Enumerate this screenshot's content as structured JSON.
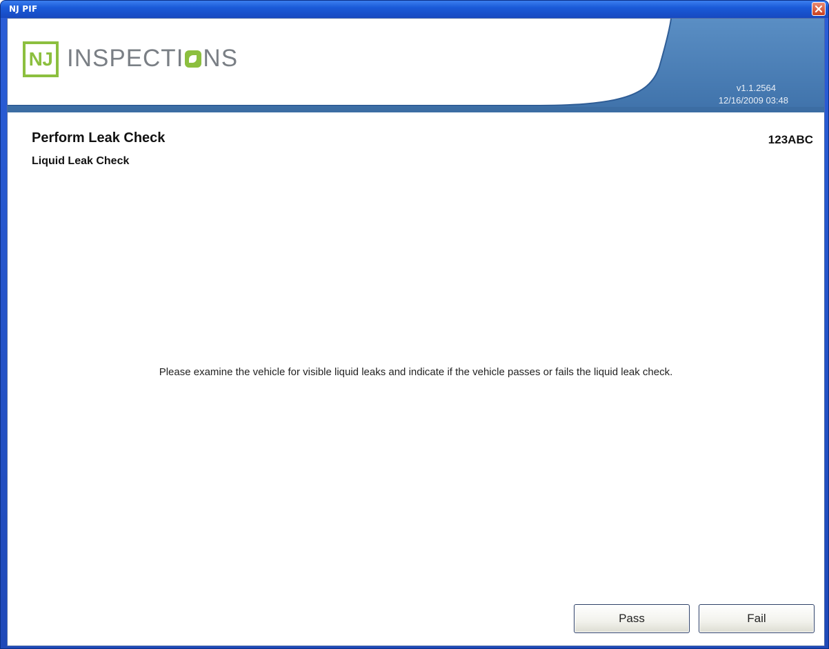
{
  "window": {
    "title": "NJ PIF"
  },
  "header": {
    "logo_mark": "NJ",
    "logo_text_before": "INSPECTI",
    "logo_text_after": "NS",
    "version": "v1.1.2564",
    "datetime": "12/16/2009 03:48"
  },
  "page": {
    "title": "Perform Leak Check",
    "subtitle": "Liquid Leak Check",
    "plate": "123ABC",
    "instructions": "Please examine the vehicle for visible liquid leaks and indicate if the vehicle passes or fails the liquid leak check."
  },
  "buttons": {
    "pass_label": "Pass",
    "fail_label": "Fail"
  },
  "colors": {
    "brand_green": "#8cbf3f",
    "header_blue": "#4d7fb5",
    "titlebar_blue": "#1a5ad8"
  },
  "icons": {
    "close": "close-icon",
    "logo_o": "leaf-o-icon"
  }
}
